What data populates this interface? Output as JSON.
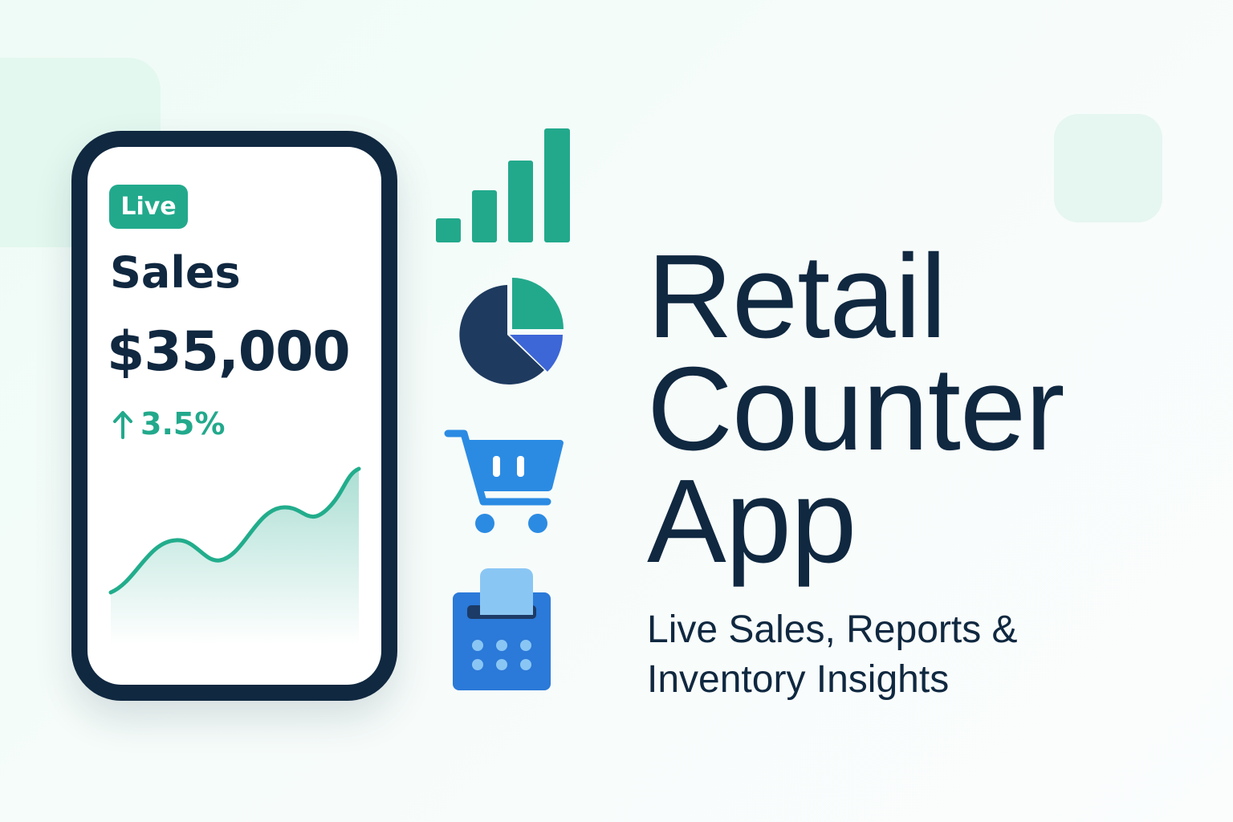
{
  "phone": {
    "badge": "Live",
    "metric_label": "Sales",
    "metric_value": "$35,000",
    "change": "3.5%"
  },
  "title_lines": [
    "Retail",
    "Counter",
    "App"
  ],
  "subtitle_lines": [
    "Live Sales, Reports &",
    "Inventory Insights"
  ],
  "icons": [
    "bar-chart-icon",
    "pie-chart-icon",
    "shopping-cart-icon",
    "cash-register-icon"
  ],
  "colors": {
    "navy": "#102840",
    "teal": "#22a98c",
    "blue": "#2b8be3",
    "light_blue": "#8ac6f4",
    "pie_blue": "#3d66d6"
  }
}
